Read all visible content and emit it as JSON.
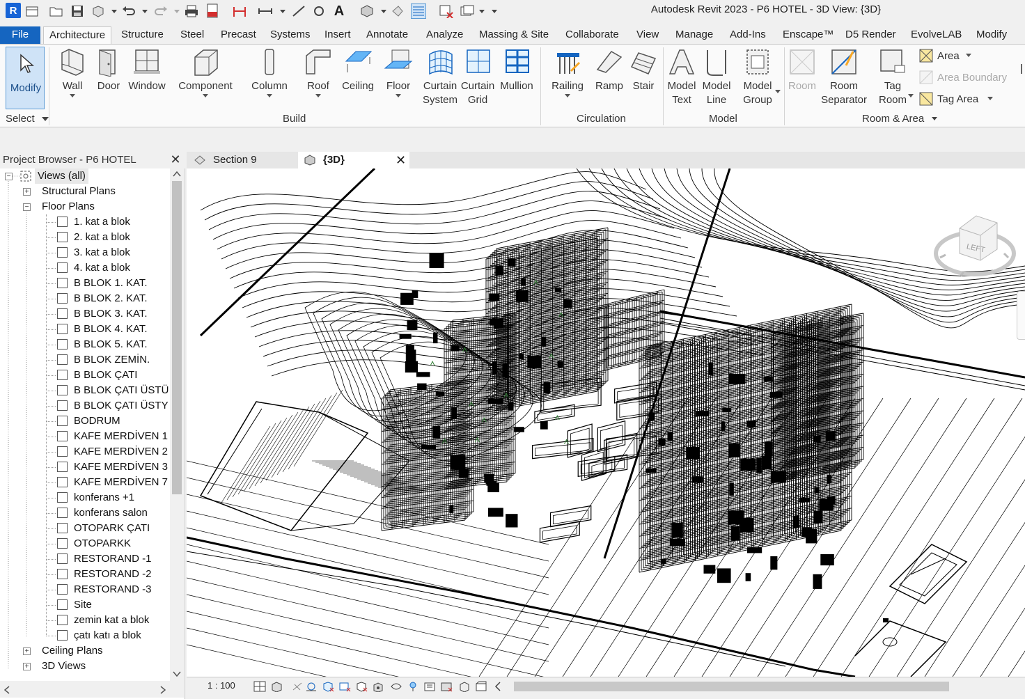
{
  "window": {
    "title": "Autodesk Revit 2023 - P6 HOTEL - 3D View: {3D}",
    "app_logo": "R"
  },
  "tabs": [
    {
      "label": "File"
    },
    {
      "label": "Architecture"
    },
    {
      "label": "Structure"
    },
    {
      "label": "Steel"
    },
    {
      "label": "Precast"
    },
    {
      "label": "Systems"
    },
    {
      "label": "Insert"
    },
    {
      "label": "Annotate"
    },
    {
      "label": "Analyze"
    },
    {
      "label": "Massing & Site"
    },
    {
      "label": "Collaborate"
    },
    {
      "label": "View"
    },
    {
      "label": "Manage"
    },
    {
      "label": "Add-Ins"
    },
    {
      "label": "Enscape™"
    },
    {
      "label": "D5 Render"
    },
    {
      "label": "EvolveLAB"
    },
    {
      "label": "Modify"
    }
  ],
  "ribbon": {
    "modify": "Modify",
    "select": "Select",
    "build": {
      "label": "Build",
      "wall": "Wall",
      "door": "Door",
      "window": "Window",
      "component": "Component",
      "column": "Column",
      "roof": "Roof",
      "ceiling": "Ceiling",
      "floor": "Floor",
      "curtain_system": [
        "Curtain",
        "System"
      ],
      "curtain_grid": [
        "Curtain",
        "Grid"
      ],
      "mullion": "Mullion"
    },
    "circulation": {
      "label": "Circulation",
      "railing": "Railing",
      "ramp": "Ramp",
      "stair": "Stair"
    },
    "model": {
      "label": "Model",
      "model_text": [
        "Model",
        "Text"
      ],
      "model_line": [
        "Model",
        "Line"
      ],
      "model_group": [
        "Model",
        "Group"
      ]
    },
    "room_area": {
      "label": "Room & Area",
      "room": "Room",
      "room_separator": [
        "Room",
        "Separator"
      ],
      "tag_room": [
        "Tag",
        "Room"
      ],
      "area": "Area",
      "area_boundary": "Area  Boundary",
      "tag_area": "Tag  Area"
    }
  },
  "project_browser": {
    "title": "Project Browser - P6 HOTEL",
    "root": "Views (all)",
    "structural_plans": "Structural Plans",
    "floor_plans": "Floor Plans",
    "floor_plan_items": [
      "1. kat a blok",
      "2. kat a blok",
      "3. kat a blok",
      "4. kat a blok",
      "B BLOK 1. KAT.",
      "B BLOK 2. KAT.",
      "B BLOK 3. KAT.",
      "B BLOK 4. KAT.",
      "B BLOK 5. KAT.",
      "B BLOK ZEMİN.",
      "B BLOK ÇATI",
      "B BLOK ÇATI ÜSTÜ",
      "B BLOK ÇATI ÜSTY",
      "BODRUM",
      "KAFE MERDİVEN 1",
      "KAFE MERDİVEN 2",
      "KAFE MERDİVEN 3",
      "KAFE MERDİVEN 7",
      "konferans +1",
      "konferans salon",
      "OTOPARK ÇATI",
      "OTOPARKK",
      "RESTORAND -1",
      "RESTORAND -2",
      "RESTORAND -3",
      "Site",
      "zemin kat a blok",
      "çatı katı a blok"
    ],
    "ceiling_plans": "Ceiling Plans",
    "views_3d": "3D Views"
  },
  "view_tabs": [
    {
      "label": "Section 9"
    },
    {
      "label": "{3D}"
    }
  ],
  "viewcube": {
    "face": "LEFT"
  },
  "view_control": {
    "scale": "1 : 100"
  }
}
